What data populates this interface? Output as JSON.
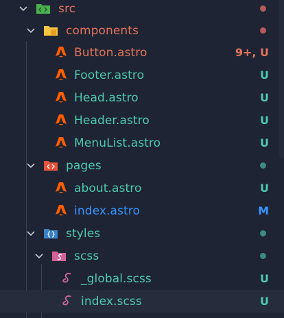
{
  "colors": {
    "modified": "#e2725b",
    "untracked": "#4ec9b0",
    "modified_file": "#3794ff",
    "dot_modified": "#b55a5a",
    "dot_untracked": "#3e8a82",
    "icon_astro": "#ff5d01"
  },
  "tree": [
    {
      "label": "src",
      "status": "",
      "kind": "folder-src",
      "dot": "modified"
    },
    {
      "label": "components",
      "status": "",
      "kind": "folder-components",
      "dot": "modified"
    },
    {
      "label": "Button.astro",
      "status": "9+, U",
      "kind": "astro-file"
    },
    {
      "label": "Footer.astro",
      "status": "U",
      "kind": "astro-file"
    },
    {
      "label": "Head.astro",
      "status": "U",
      "kind": "astro-file"
    },
    {
      "label": "Header.astro",
      "status": "U",
      "kind": "astro-file"
    },
    {
      "label": "MenuList.astro",
      "status": "U",
      "kind": "astro-file"
    },
    {
      "label": "pages",
      "status": "",
      "kind": "folder-pages",
      "dot": "untracked"
    },
    {
      "label": "about.astro",
      "status": "U",
      "kind": "astro-file"
    },
    {
      "label": "index.astro",
      "status": "M",
      "kind": "astro-file"
    },
    {
      "label": "styles",
      "status": "",
      "kind": "folder-styles",
      "dot": "untracked"
    },
    {
      "label": "scss",
      "status": "",
      "kind": "folder-scss",
      "dot": "untracked"
    },
    {
      "label": "_global.scss",
      "status": "U",
      "kind": "scss-file"
    },
    {
      "label": "index.scss",
      "status": "U",
      "kind": "scss-file"
    }
  ]
}
